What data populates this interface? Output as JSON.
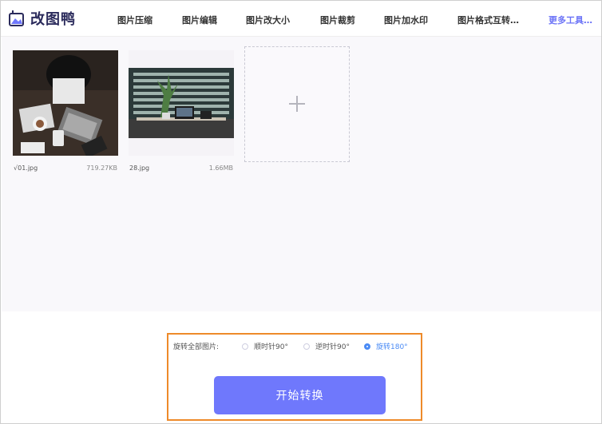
{
  "app": {
    "name": "改图鸭"
  },
  "nav": {
    "items": [
      "图片压缩",
      "图片编辑",
      "图片改大小",
      "图片裁剪",
      "图片加水印",
      "图片格式互转…"
    ],
    "more": "更多工具…"
  },
  "files": [
    {
      "name": "√01.jpg",
      "size": "719.27KB"
    },
    {
      "name": "28.jpg",
      "size": "1.66MB"
    }
  ],
  "rotate": {
    "label": "旋转全部图片:",
    "options": [
      "顺时针90°",
      "逆时针90°",
      "旋转180°"
    ],
    "selected": "旋转180°"
  },
  "start_button": "开始转换",
  "colors": {
    "accent": "#6f78fc",
    "highlight_border": "#ee8a2a",
    "radio_selected": "#4b8bf5"
  }
}
